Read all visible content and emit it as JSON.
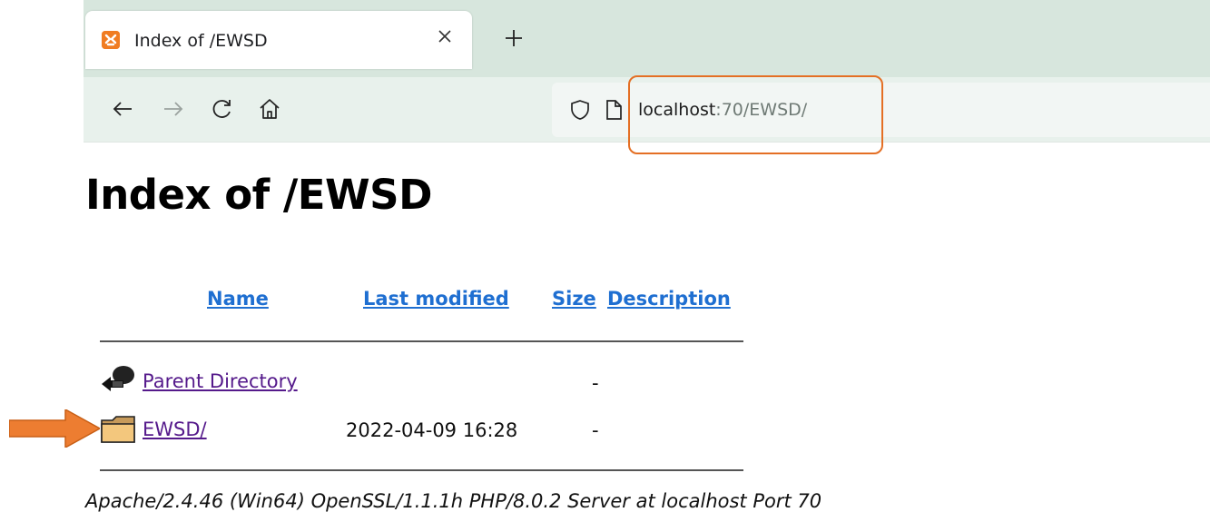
{
  "browser": {
    "tab_title": "Index of /EWSD",
    "url_host": "localhost",
    "url_rest": ":70/EWSD/",
    "icons": [
      "xampp-favicon",
      "close-icon",
      "plus-icon",
      "back-arrow-icon",
      "forward-arrow-icon",
      "reload-icon",
      "home-icon",
      "shield-icon",
      "page-icon"
    ]
  },
  "page": {
    "heading": "Index of /EWSD",
    "columns": {
      "name": "Name",
      "last_modified": "Last modified",
      "size": "Size",
      "description": "Description"
    },
    "rows": [
      {
        "name": "Parent Directory",
        "last_modified": "",
        "size": "-",
        "icon": "parent-directory-icon"
      },
      {
        "name": "EWSD/",
        "last_modified": "2022-04-09 16:28",
        "size": "-",
        "icon": "folder-icon"
      }
    ],
    "server_signature": "Apache/2.4.46 (Win64) OpenSSL/1.1.1h PHP/8.0.2 Server at localhost Port 70"
  },
  "colors": {
    "annotation_orange": "#e46f24",
    "link_blue": "#1f6fd1",
    "visited_purple": "#551a8b",
    "tabbar_green": "#d7e6dd"
  }
}
